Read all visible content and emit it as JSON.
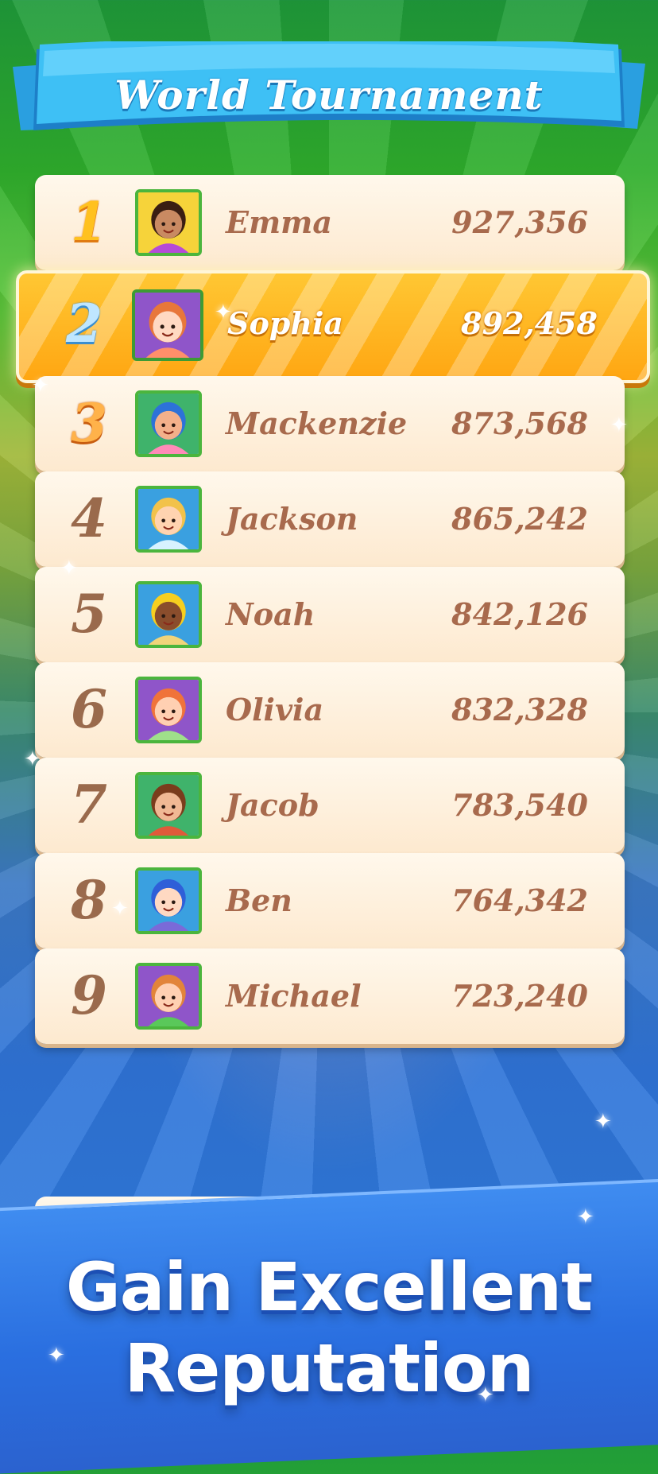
{
  "banner": {
    "title": "World Tournament"
  },
  "leaderboard": [
    {
      "rank": "1",
      "name": "Emma",
      "score": "927,356",
      "avatar": "girl-dark-hair-avatar",
      "avatar_bg": "#f6d33a",
      "hair": "#3a1e12",
      "skin": "#c98a62",
      "shirt": "#b54bd8"
    },
    {
      "rank": "2",
      "name": "Sophia",
      "score": "892,458",
      "avatar": "girl-red-hair-avatar",
      "avatar_bg": "#8f55c9",
      "hair": "#e8773a",
      "skin": "#ffd9c2",
      "shirt": "#ff8f6a"
    },
    {
      "rank": "3",
      "name": "Mackenzie",
      "score": "873,568",
      "avatar": "girl-blue-hair-avatar",
      "avatar_bg": "#3fb36b",
      "hair": "#2d72d8",
      "skin": "#f3b08a",
      "shirt": "#ff8ab8"
    },
    {
      "rank": "4",
      "name": "Jackson",
      "score": "865,242",
      "avatar": "boy-blond-hair-avatar",
      "avatar_bg": "#3aa0e0",
      "hair": "#f2c24a",
      "skin": "#ffd3b0",
      "shirt": "#d8f2ff"
    },
    {
      "rank": "5",
      "name": "Noah",
      "score": "842,126",
      "avatar": "boy-yellow-hat-avatar",
      "avatar_bg": "#3aa0e0",
      "hair": "#f7cf1f",
      "skin": "#8a4d2c",
      "shirt": "#f1d47a"
    },
    {
      "rank": "6",
      "name": "Olivia",
      "score": "832,328",
      "avatar": "girl-orange-hair-avatar",
      "avatar_bg": "#8f55c9",
      "hair": "#f0733a",
      "skin": "#ffd0b2",
      "shirt": "#9fe08a"
    },
    {
      "rank": "7",
      "name": "Jacob",
      "score": "783,540",
      "avatar": "boy-curly-hair-avatar",
      "avatar_bg": "#3fb36b",
      "hair": "#7a3c1c",
      "skin": "#f0b894",
      "shirt": "#e05a3a"
    },
    {
      "rank": "8",
      "name": "Ben",
      "score": "764,342",
      "avatar": "boy-blue-hair-avatar",
      "avatar_bg": "#3aa0e0",
      "hair": "#2f5fd8",
      "skin": "#ffd9c2",
      "shirt": "#7a6ad8"
    },
    {
      "rank": "9",
      "name": "Michael",
      "score": "723,240",
      "avatar": "boy-ginger-hair-avatar",
      "avatar_bg": "#8f55c9",
      "hair": "#e2843a",
      "skin": "#ffd0b2",
      "shirt": "#5ac85a"
    }
  ],
  "highlighted_rank": "2",
  "slogan": {
    "line1": "Gain Excellent",
    "line2": "Reputation"
  },
  "colors": {
    "row_text": "#a86a4d",
    "highlight": "#ffb520",
    "banner": "#3ec0f5",
    "footer": "#2f74e0"
  }
}
